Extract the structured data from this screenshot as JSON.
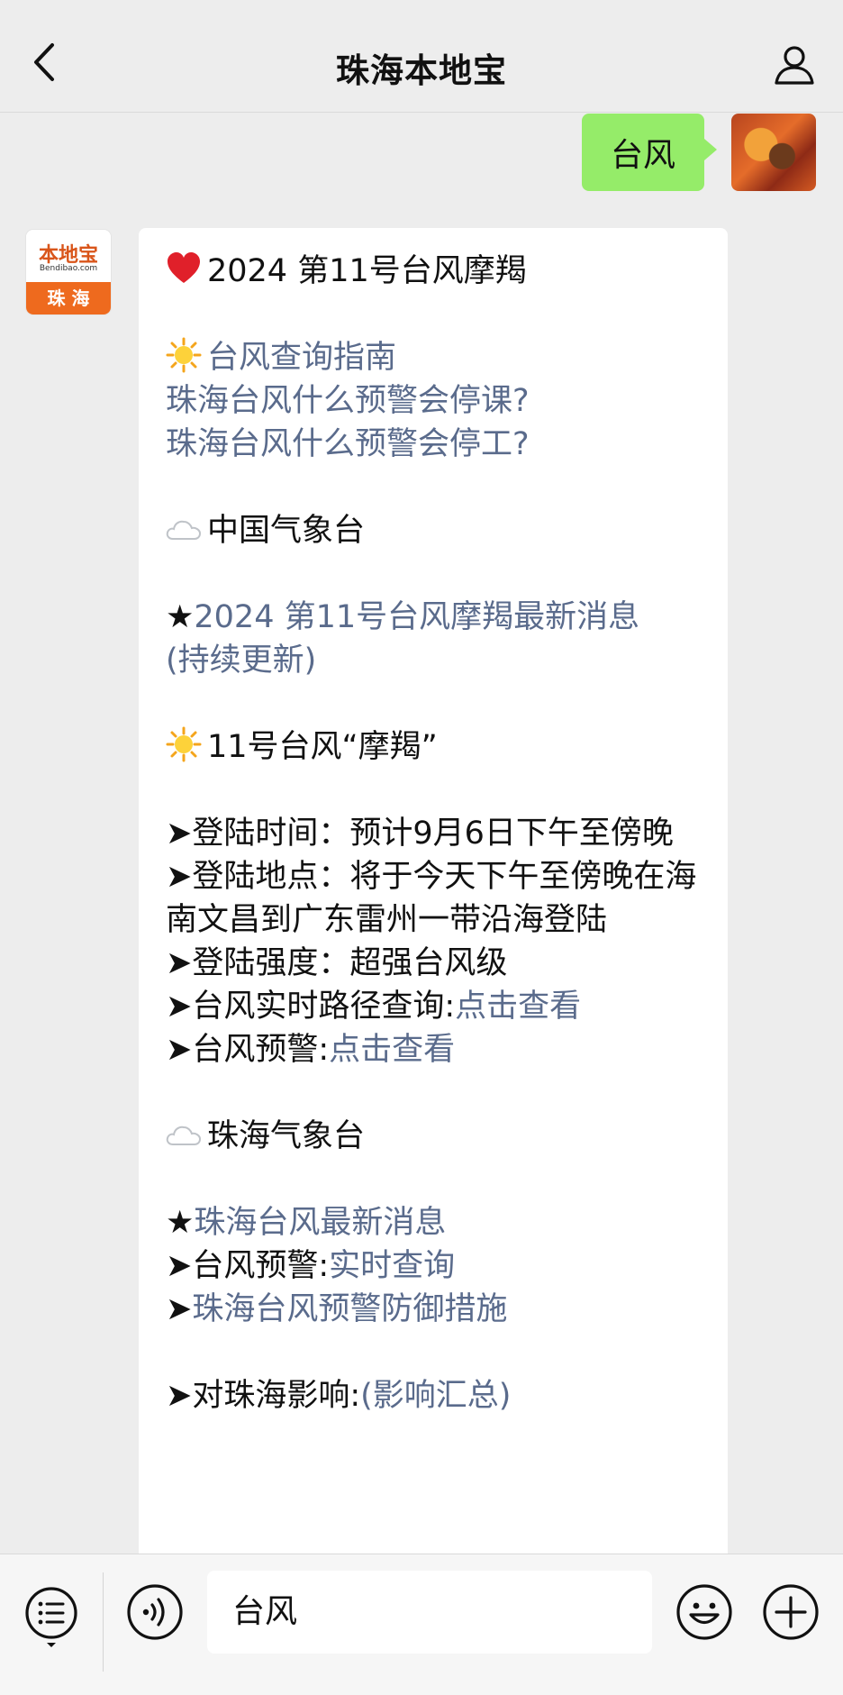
{
  "header": {
    "title": "珠海本地宝"
  },
  "outgoing": {
    "text": "台风"
  },
  "bot": {
    "logo_top": "本地宝",
    "logo_sub": "Bendibao.com",
    "logo_city": "珠 海"
  },
  "message": {
    "l1": "2024 第11号台风摩羯",
    "l2": "台风查询指南",
    "l3": "珠海台风什么预警会停课?",
    "l4": "珠海台风什么预警会停工?",
    "l5": "中国气象台",
    "l6_star": "★",
    "l6": "2024 第11号台风摩羯最新消息",
    "l7": "(持续更新)",
    "l8": "11号台风“摩羯”",
    "l9": "➤登陆时间：预计9月6日下午至傍晚",
    "l10": "➤登陆地点：将于今天下午至傍晚在海南文昌到广东雷州一带沿海登陆",
    "l11": "➤登陆强度：超强台风级",
    "l12_pre": "➤台风实时路径查询:",
    "l12_link": "点击查看",
    "l13_pre": "➤台风预警:",
    "l13_link": "点击查看",
    "l14": "珠海气象台",
    "l15_star": "★",
    "l15": "珠海台风最新消息",
    "l16_pre": "➤台风预警:",
    "l16_link": "实时查询",
    "l17_pre": "➤",
    "l17_link": "珠海台风预警防御措施",
    "l18_pre": "➤对珠海影响:",
    "l18_link": "(影响汇总)"
  },
  "input": {
    "value": "台风"
  },
  "colors": {
    "outgoing_bubble": "#95ec69",
    "link": "#5a6b8c",
    "brand_orange": "#ee6a1e",
    "background": "#ededed"
  }
}
